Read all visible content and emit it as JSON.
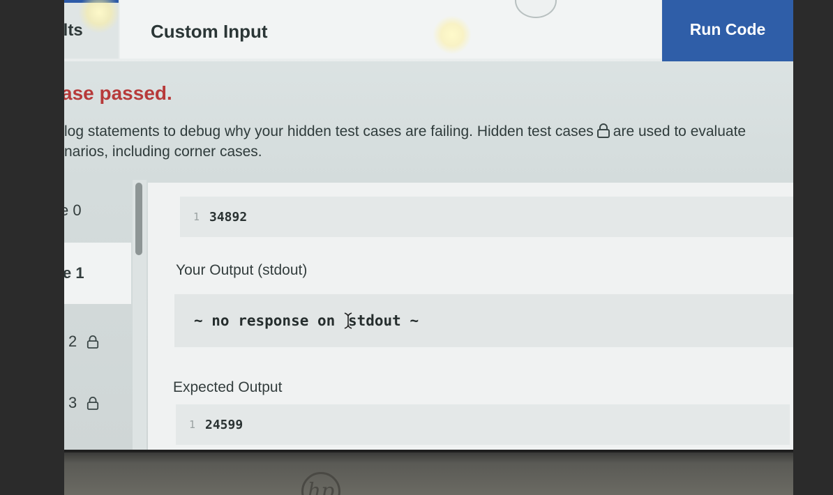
{
  "tabs": {
    "results_label": "ılts",
    "custom_input_label": "Custom Input"
  },
  "run_button": {
    "label": "Run Code"
  },
  "status": {
    "title": "ase passed.",
    "desc_line1_a": "log statements to debug why your hidden test cases are failing. Hidden test cases",
    "desc_line1_b": "are used to evaluate",
    "desc_line2": "narios, including corner cases."
  },
  "test_cases": [
    {
      "label": "e 0",
      "locked": false,
      "active": false
    },
    {
      "label": "e 1",
      "locked": false,
      "active": true
    },
    {
      "label": "2",
      "locked": true,
      "active": false
    },
    {
      "label": "3",
      "locked": true,
      "active": false
    }
  ],
  "input": {
    "line_number": "1",
    "value": "34892"
  },
  "your_output": {
    "label": "Your Output (stdout)",
    "text_a": "~ no response on ",
    "text_b": "stdout ~"
  },
  "expected_output": {
    "label": "Expected Output",
    "line_number": "1",
    "value": "24599"
  },
  "bezel": {
    "logo": "hp"
  },
  "colors": {
    "run_button_bg": "#2f5ea8",
    "status_error": "#b73a3a",
    "panel_bg": "#f0f2f2"
  },
  "icons": {
    "lock": "lock-icon",
    "text_cursor": "text-cursor-icon",
    "toggle": "panel-toggle-icon"
  }
}
